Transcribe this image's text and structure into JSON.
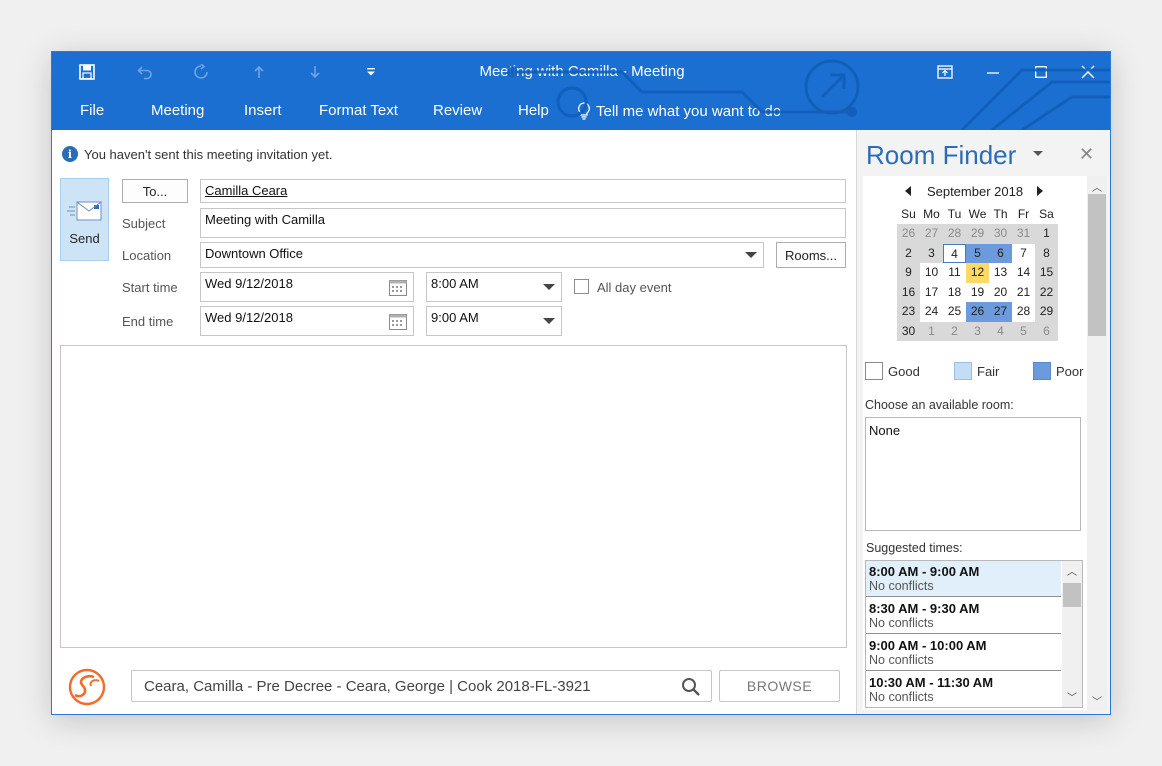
{
  "window": {
    "title": "Meeting with Camilla  -  Meeting",
    "accent_color": "#1a6fd0",
    "controls": [
      "restore-ribbon-icon",
      "minimize-icon",
      "maximize-icon",
      "close-icon"
    ]
  },
  "quick_access": [
    "save-icon",
    "undo-icon",
    "redo-icon",
    "up-arrow-icon",
    "down-arrow-icon",
    "customize-icon"
  ],
  "ribbon": {
    "tabs": [
      {
        "label": "File"
      },
      {
        "label": "Meeting"
      },
      {
        "label": "Insert"
      },
      {
        "label": "Format Text"
      },
      {
        "label": "Review"
      },
      {
        "label": "Help"
      }
    ],
    "tell_me": "Tell me what you want to do"
  },
  "compose": {
    "info": "You haven't sent this meeting invitation yet.",
    "send_label": "Send",
    "to_button": "To...",
    "to_value": "Camilla Ceara",
    "subject_label": "Subject",
    "subject_value": "Meeting with Camilla",
    "location_label": "Location",
    "location_value": "Downtown Office",
    "rooms_button": "Rooms...",
    "start_label": "Start time",
    "start_date": "Wed 9/12/2018",
    "start_time": "8:00 AM",
    "all_day_label": "All day event",
    "all_day_checked": false,
    "end_label": "End time",
    "end_date": "Wed 9/12/2018",
    "end_time": "9:00 AM"
  },
  "addin": {
    "search_value": "Ceara, Camilla - Pre Decree - Ceara, George | Cook 2018-FL-3921",
    "browse_button": "BROWSE"
  },
  "room_finder": {
    "title": "Room Finder",
    "month_label": "September 2018",
    "days_of_week": [
      "Su",
      "Mo",
      "Tu",
      "We",
      "Th",
      "Fr",
      "Sa"
    ],
    "weeks": [
      [
        {
          "d": "26",
          "k": "out"
        },
        {
          "d": "27",
          "k": "out"
        },
        {
          "d": "28",
          "k": "out"
        },
        {
          "d": "29",
          "k": "out"
        },
        {
          "d": "30",
          "k": "out"
        },
        {
          "d": "31",
          "k": "out"
        },
        {
          "d": "1",
          "k": "weekend"
        }
      ],
      [
        {
          "d": "2",
          "k": "weekend"
        },
        {
          "d": "3",
          "k": "weekend"
        },
        {
          "d": "4",
          "k": "selected"
        },
        {
          "d": "5",
          "k": "poor"
        },
        {
          "d": "6",
          "k": "poor"
        },
        {
          "d": "7",
          "k": "good"
        },
        {
          "d": "8",
          "k": "weekend"
        }
      ],
      [
        {
          "d": "9",
          "k": "weekend"
        },
        {
          "d": "10",
          "k": "good"
        },
        {
          "d": "11",
          "k": "good"
        },
        {
          "d": "12",
          "k": "today"
        },
        {
          "d": "13",
          "k": "good"
        },
        {
          "d": "14",
          "k": "good"
        },
        {
          "d": "15",
          "k": "weekend"
        }
      ],
      [
        {
          "d": "16",
          "k": "weekend"
        },
        {
          "d": "17",
          "k": "good"
        },
        {
          "d": "18",
          "k": "good"
        },
        {
          "d": "19",
          "k": "good"
        },
        {
          "d": "20",
          "k": "good"
        },
        {
          "d": "21",
          "k": "good"
        },
        {
          "d": "22",
          "k": "weekend"
        }
      ],
      [
        {
          "d": "23",
          "k": "weekend"
        },
        {
          "d": "24",
          "k": "good"
        },
        {
          "d": "25",
          "k": "good"
        },
        {
          "d": "26",
          "k": "poor"
        },
        {
          "d": "27",
          "k": "poor"
        },
        {
          "d": "28",
          "k": "good"
        },
        {
          "d": "29",
          "k": "weekend"
        }
      ],
      [
        {
          "d": "30",
          "k": "weekend"
        },
        {
          "d": "1",
          "k": "out"
        },
        {
          "d": "2",
          "k": "out"
        },
        {
          "d": "3",
          "k": "out"
        },
        {
          "d": "4",
          "k": "out"
        },
        {
          "d": "5",
          "k": "out"
        },
        {
          "d": "6",
          "k": "out"
        }
      ]
    ],
    "legend": [
      {
        "label": "Good",
        "color": "#ffffff"
      },
      {
        "label": "Fair",
        "color": "#c5dcf5"
      },
      {
        "label": "Poor",
        "color": "#6b9bdc"
      }
    ],
    "choose_label": "Choose an available room:",
    "room_value": "None",
    "suggested_label": "Suggested times:",
    "suggested": [
      {
        "time": "8:00 AM - 9:00 AM",
        "status": "No conflicts"
      },
      {
        "time": "8:30 AM - 9:30 AM",
        "status": "No conflicts"
      },
      {
        "time": "9:00 AM - 10:00 AM",
        "status": "No conflicts"
      },
      {
        "time": "10:30 AM - 11:30 AM",
        "status": "No conflicts"
      }
    ]
  }
}
